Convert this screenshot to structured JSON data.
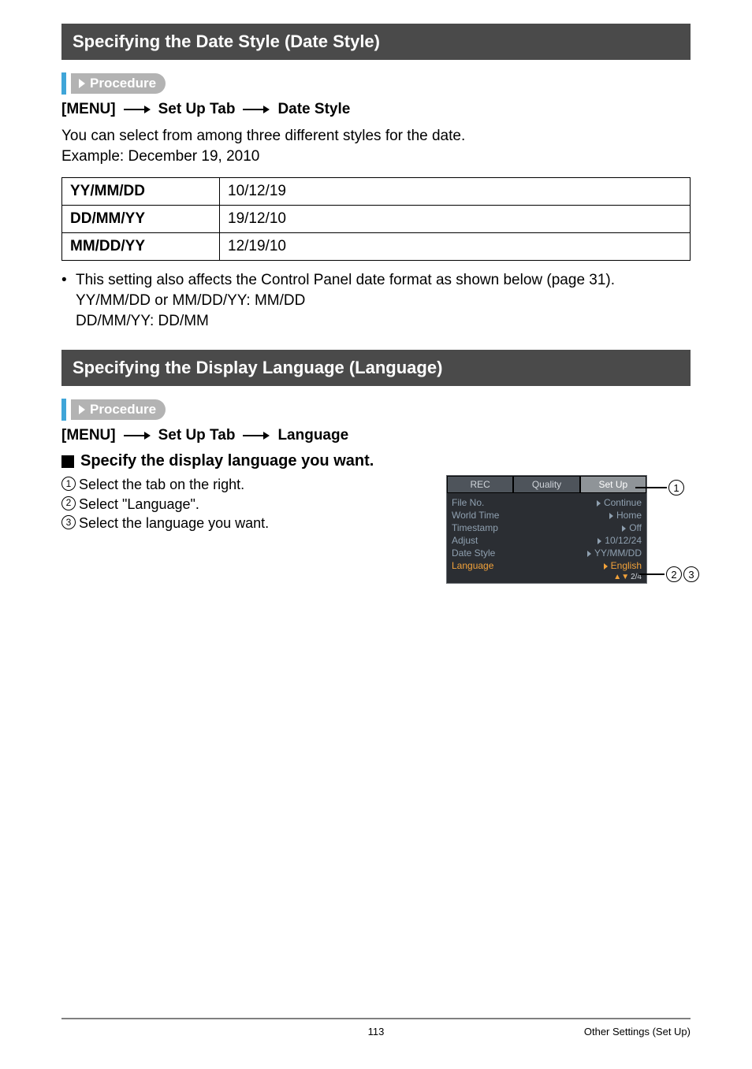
{
  "sections": {
    "date_style_title": "Specifying the Date Style (Date Style)",
    "language_title": "Specifying the Display Language (Language)"
  },
  "procedure_label": "Procedure",
  "menu_paths": {
    "date_style": {
      "btn": "[MENU]",
      "mid": "Set Up Tab",
      "end": "Date Style"
    },
    "language": {
      "btn": "[MENU]",
      "mid": "Set Up Tab",
      "end": "Language"
    }
  },
  "date_style": {
    "intro1": "You can select from among three different styles for the date.",
    "intro2": "Example: December 19, 2010",
    "rows": [
      {
        "fmt": "YY/MM/DD",
        "ex": "10/12/19"
      },
      {
        "fmt": "DD/MM/YY",
        "ex": "19/12/10"
      },
      {
        "fmt": "MM/DD/YY",
        "ex": "12/19/10"
      }
    ],
    "bullet_lines": [
      "This setting also affects the Control Panel date format as shown below (page 31).",
      "YY/MM/DD or MM/DD/YY: MM/DD",
      "DD/MM/YY: DD/MM"
    ]
  },
  "language": {
    "sub_title": "Specify the display language you want.",
    "steps": [
      "Select the tab on the right.",
      "Select \"Language\".",
      "Select the language you want."
    ],
    "screenshot": {
      "tabs": [
        "REC",
        "Quality",
        "Set Up"
      ],
      "active_tab": 2,
      "rows": [
        {
          "label": "File No.",
          "value": "Continue",
          "selected": false
        },
        {
          "label": "World Time",
          "value": "Home",
          "selected": false
        },
        {
          "label": "Timestamp",
          "value": "Off",
          "selected": false
        },
        {
          "label": "Adjust",
          "value": "10/12/24",
          "selected": false
        },
        {
          "label": "Date Style",
          "value": "YY/MM/DD",
          "selected": false
        },
        {
          "label": "Language",
          "value": "English",
          "selected": true
        }
      ],
      "page_indicator": "2/4"
    },
    "callouts": {
      "c1": "1",
      "c2": "2",
      "c3": "3"
    }
  },
  "footer": {
    "page": "113",
    "chapter": "Other Settings (Set Up)"
  }
}
